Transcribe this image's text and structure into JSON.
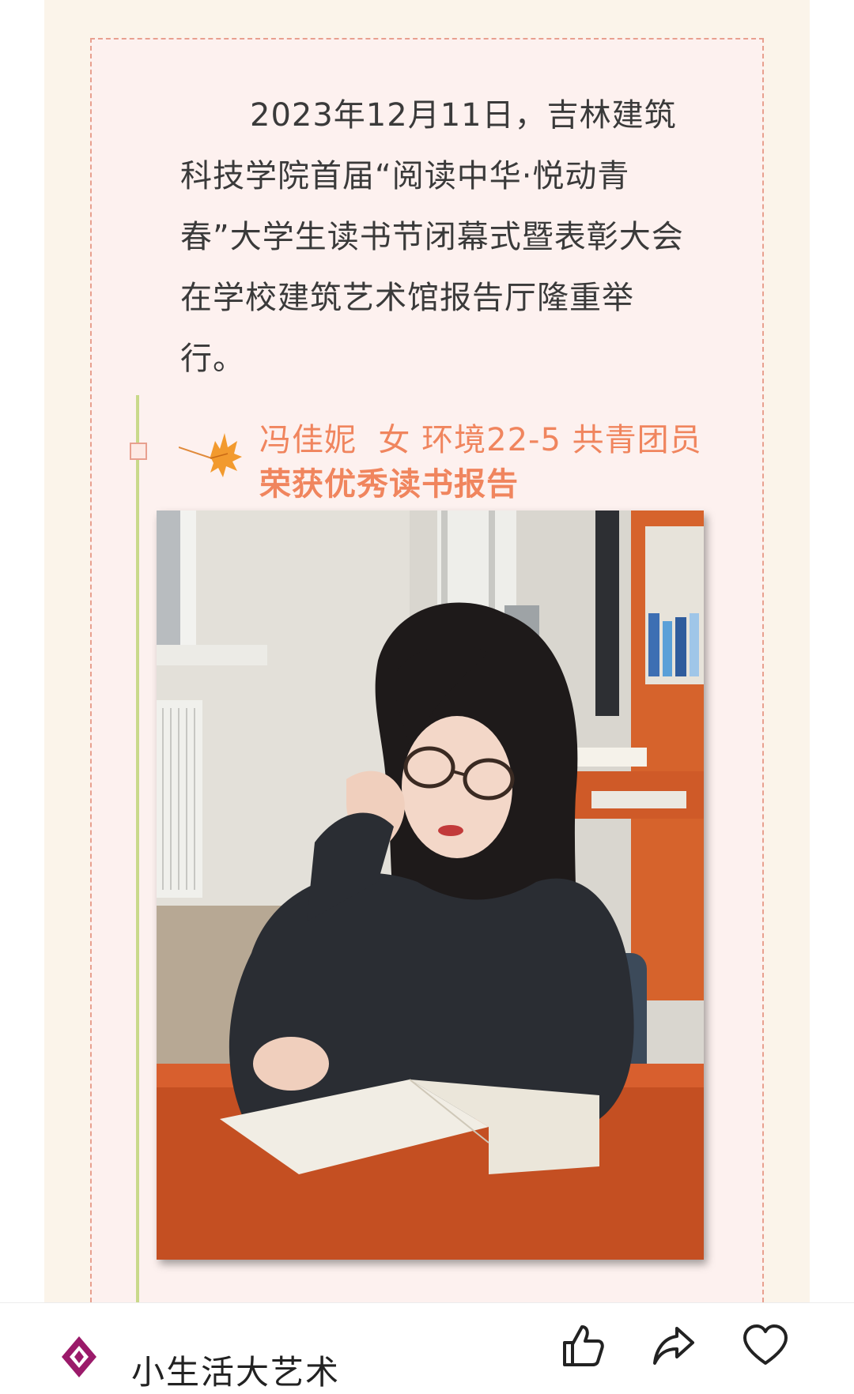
{
  "article": {
    "intro": "2023年12月11日，吉林建筑科技学院首届“阅读中华·悦动青春”大学生读书节闭幕式暨表彰大会在学校建筑艺术馆报告厅隆重举行。"
  },
  "award": {
    "name_line": "冯佳妮  女 环境22-5 共青团员",
    "title_line": "荣获优秀读书报告"
  },
  "photo": {
    "alt": "女生在图书馆看书"
  },
  "bottom_bar": {
    "account_name": "小生活大艺术",
    "actions": [
      {
        "icon": "thumb-up-icon"
      },
      {
        "icon": "share-icon"
      },
      {
        "icon": "heart-icon"
      }
    ]
  },
  "colors": {
    "accent": "#f0855e",
    "panel": "#fbf4ea",
    "dashed_border": "#e8a08f",
    "timeline": "#c9d98a"
  }
}
